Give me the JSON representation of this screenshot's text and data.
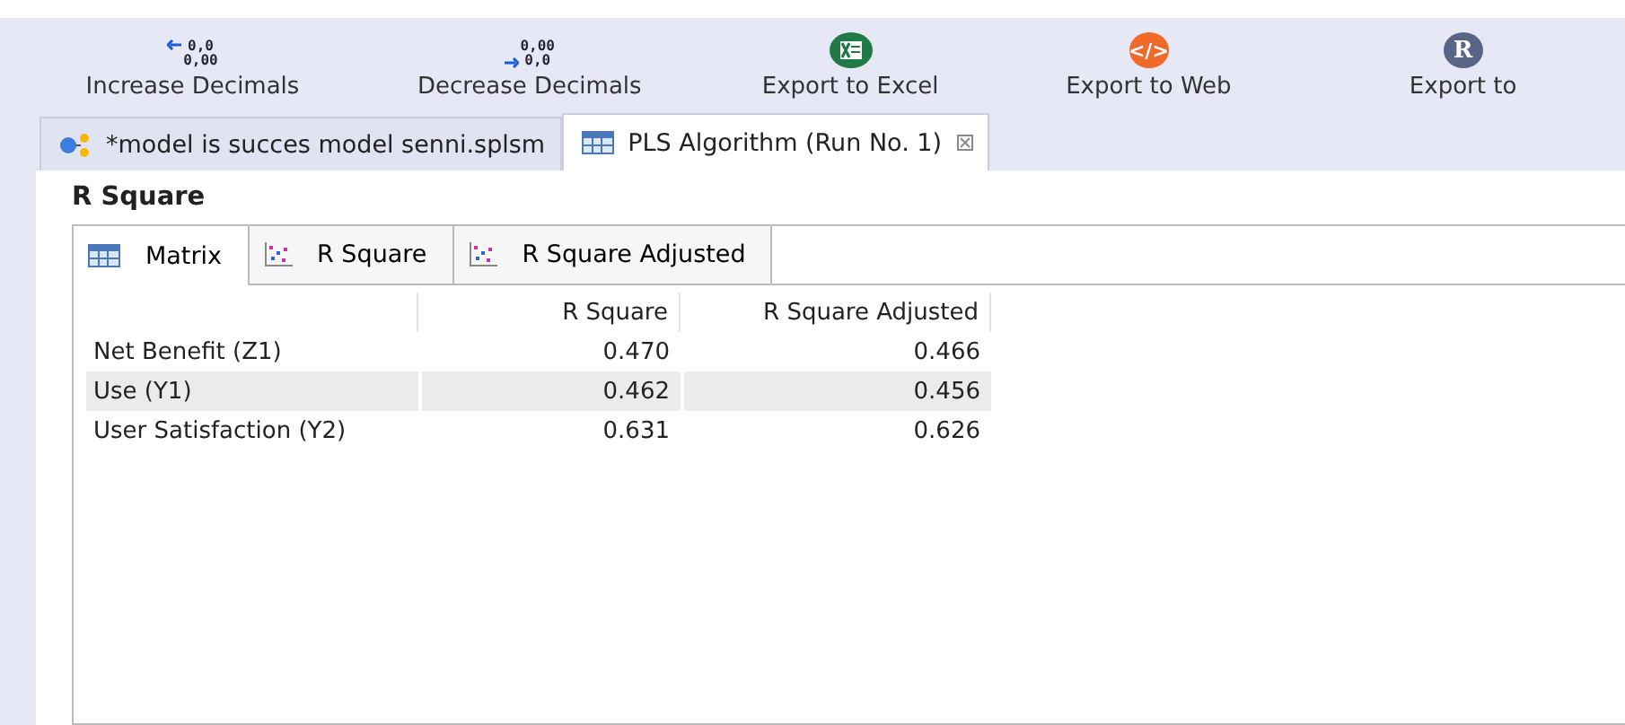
{
  "toolbar": [
    {
      "kind": "increase",
      "label": "Increase Decimals",
      "icon_lines": [
        "0,0",
        "0,00"
      ]
    },
    {
      "kind": "decrease",
      "label": "Decrease Decimals",
      "icon_lines": [
        "0,00",
        "0,0"
      ]
    },
    {
      "kind": "excel",
      "label": "Export to Excel"
    },
    {
      "kind": "web",
      "label": "Export to Web",
      "icon_text": "</>"
    },
    {
      "kind": "r",
      "label": "Export to",
      "icon_text": "R"
    }
  ],
  "editor_tabs": [
    {
      "kind": "model",
      "label": "*model is succes model senni.splsm",
      "selected": false,
      "closable": false
    },
    {
      "kind": "table",
      "label": "PLS Algorithm (Run No. 1)",
      "selected": true,
      "closable": true
    }
  ],
  "section_title": "R Square",
  "view_tabs": [
    {
      "kind": "table",
      "label": "Matrix",
      "selected": true
    },
    {
      "kind": "chart",
      "label": "R Square",
      "selected": false
    },
    {
      "kind": "chart",
      "label": "R Square Adjusted",
      "selected": false
    }
  ],
  "table": {
    "columns": [
      "R Square",
      "R Square Adjusted"
    ],
    "rows": [
      {
        "label": "Net Benefit (Z1)",
        "values": [
          "0.470",
          "0.466"
        ],
        "selected": false
      },
      {
        "label": "Use (Y1)",
        "values": [
          "0.462",
          "0.456"
        ],
        "selected": true
      },
      {
        "label": "User Satisfaction (Y2)",
        "values": [
          "0.631",
          "0.626"
        ],
        "selected": false
      }
    ]
  }
}
